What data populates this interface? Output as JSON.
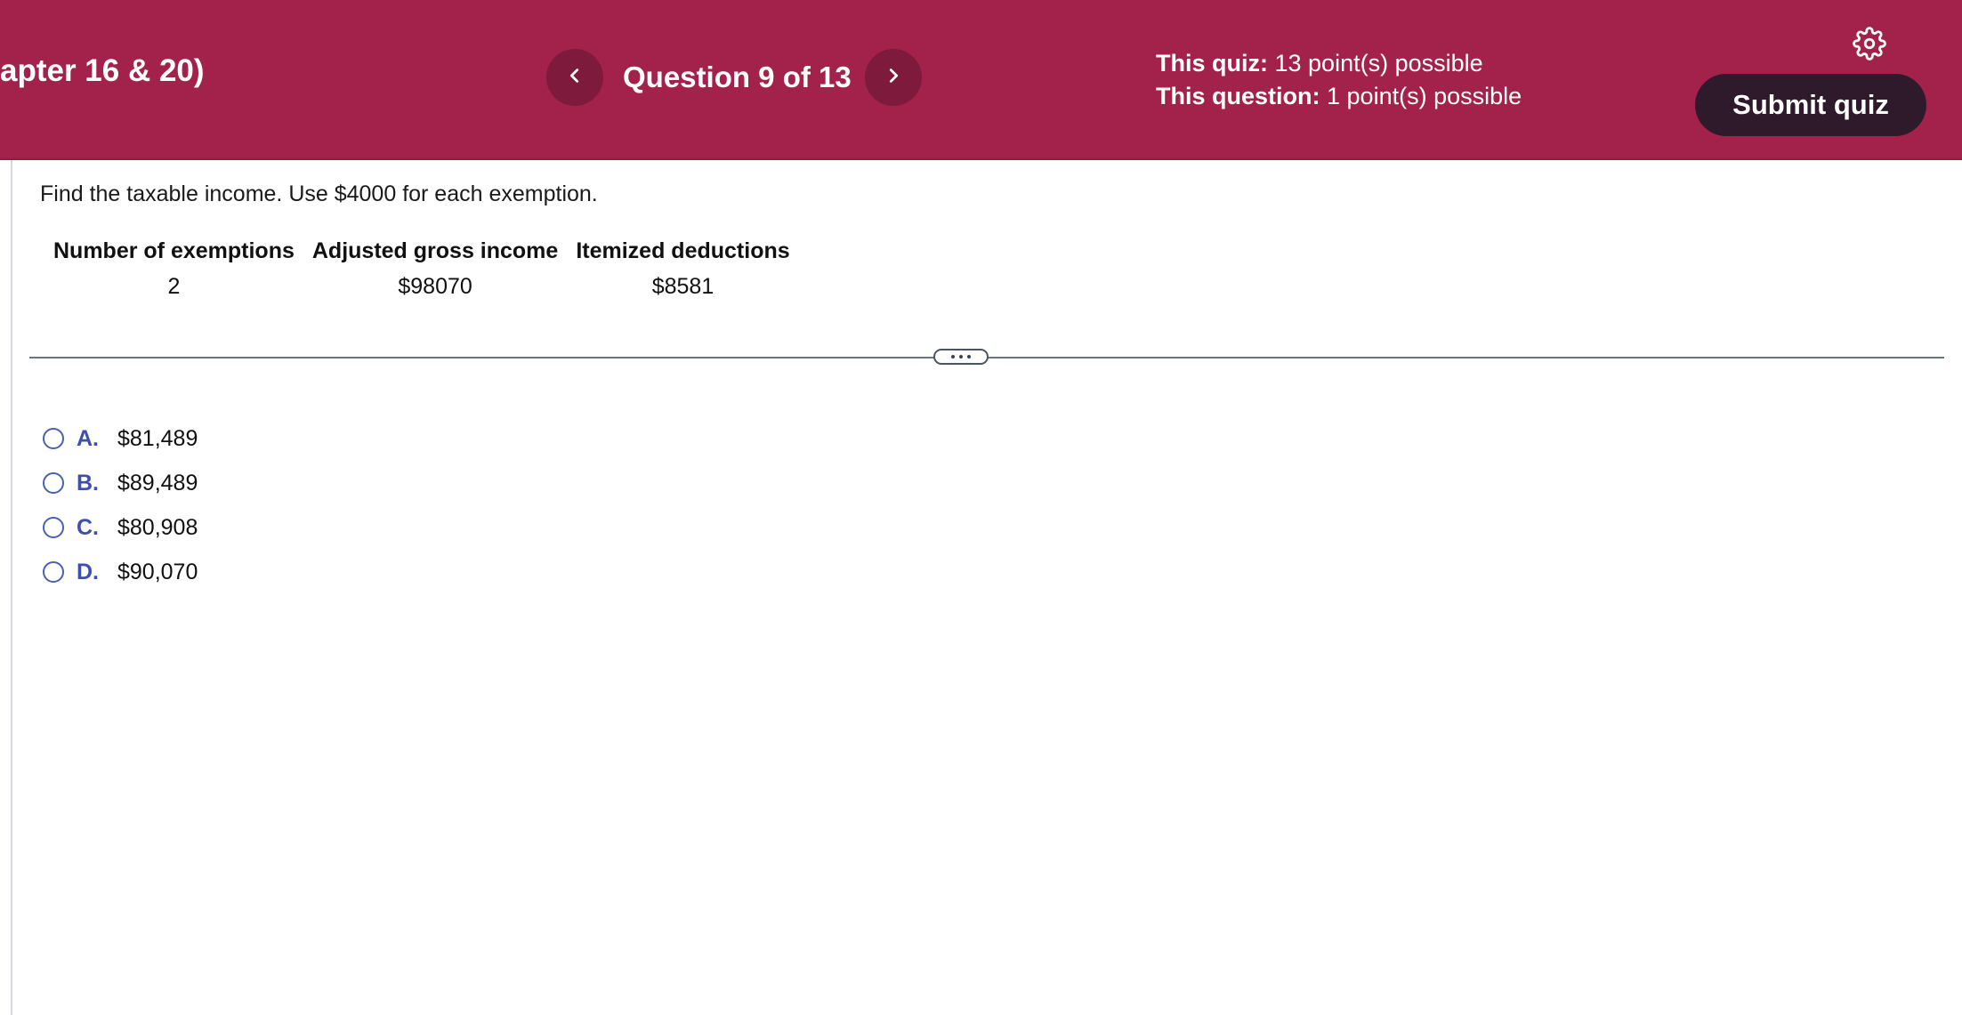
{
  "header": {
    "quiz_title": "apter 16 & 20)",
    "question_counter": "Question 9 of 13",
    "quiz_points_label": "This quiz:",
    "quiz_points_value": "13 point(s) possible",
    "question_points_label": "This question:",
    "question_points_value": "1 point(s) possible",
    "submit_label": "Submit quiz",
    "colors": {
      "bar": "#a2224b",
      "nav_button": "#7e1a3b",
      "submit_button": "#2e1a2b"
    },
    "icons": {
      "prev": "chevron-left-icon",
      "next": "chevron-right-icon",
      "settings": "gear-icon"
    }
  },
  "question": {
    "prompt": "Find the taxable income. Use $4000 for each exemption.",
    "table": {
      "headers": [
        "Number of exemptions",
        "Adjusted gross income",
        "Itemized deductions"
      ],
      "row": [
        "2",
        "$98070",
        "$8581"
      ]
    }
  },
  "options": [
    {
      "letter": "A.",
      "text": "$81,489"
    },
    {
      "letter": "B.",
      "text": "$89,489"
    },
    {
      "letter": "C.",
      "text": "$80,908"
    },
    {
      "letter": "D.",
      "text": "$90,070"
    }
  ]
}
